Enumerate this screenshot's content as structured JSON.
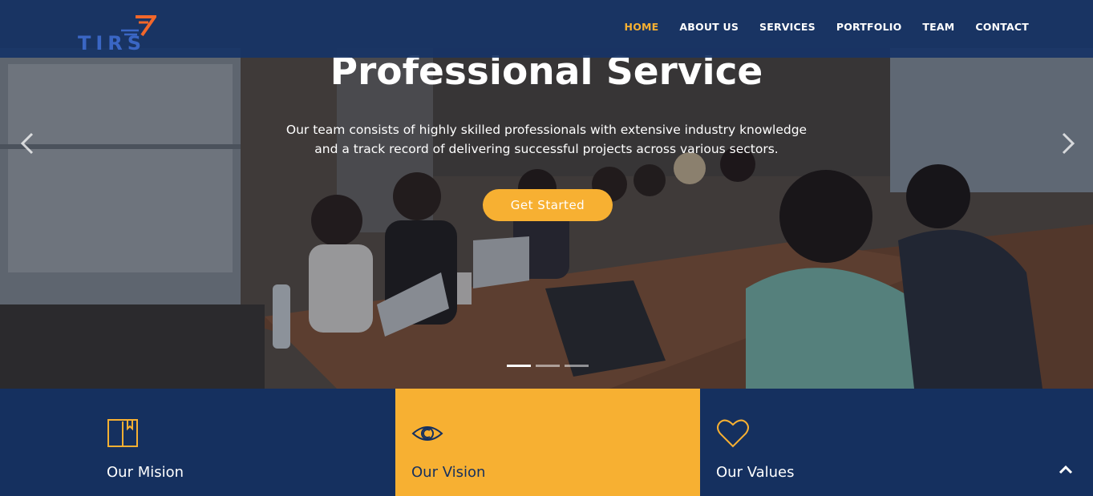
{
  "brand": {
    "logo_text": "TIRS"
  },
  "nav": {
    "items": [
      "HOME",
      "ABOUT US",
      "SERVICES",
      "PORTFOLIO",
      "TEAM",
      "CONTACT"
    ],
    "active": "HOME"
  },
  "hero": {
    "title": "Professional Service",
    "text": "Our team consists of highly skilled professionals with extensive industry knowledge and a track record of delivering successful projects across various sectors.",
    "cta": "Get Started",
    "slide_count": 3,
    "active_slide": 1
  },
  "features": [
    {
      "title": "Our Mision",
      "icon": "book-icon"
    },
    {
      "title": "Our Vision",
      "icon": "eye-icon"
    },
    {
      "title": "Our Values",
      "icon": "heart-icon"
    }
  ],
  "colors": {
    "navy": "#15305f",
    "accent": "#f7b032",
    "logo_blue": "#3a66c4",
    "logo_orange": "#f2672a"
  }
}
